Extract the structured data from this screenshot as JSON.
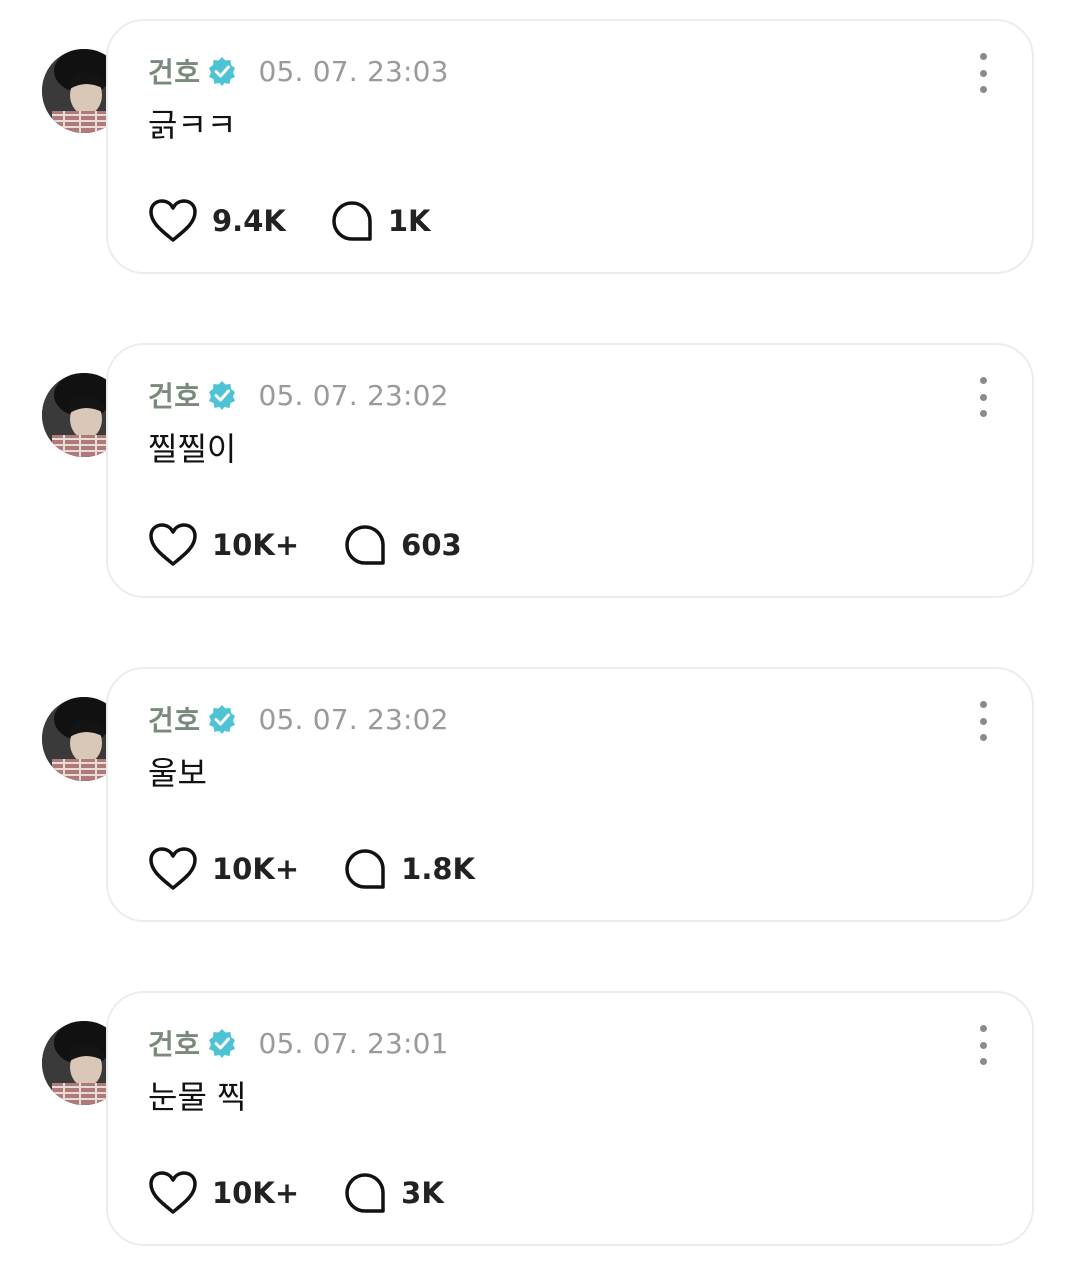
{
  "theme": {
    "name_color": "#7a8a7a",
    "verified_color": "#4fc3d6",
    "time_color": "#9a9a9a",
    "border_color": "#ececec"
  },
  "icons": {
    "verified": "verified-badge-icon",
    "like": "heart-icon",
    "comment": "comment-bubble-icon",
    "more": "more-vertical-icon"
  },
  "posts": [
    {
      "author": "건호",
      "timestamp": "05. 07. 23:03",
      "text": "긁ㅋㅋ",
      "likes": "9.4K",
      "comments": "1K"
    },
    {
      "author": "건호",
      "timestamp": "05. 07. 23:02",
      "text": "찔찔이",
      "likes": "10K+",
      "comments": "603"
    },
    {
      "author": "건호",
      "timestamp": "05. 07. 23:02",
      "text": "울보",
      "likes": "10K+",
      "comments": "1.8K"
    },
    {
      "author": "건호",
      "timestamp": "05. 07. 23:01",
      "text": "눈물 찍",
      "likes": "10K+",
      "comments": "3K"
    }
  ]
}
